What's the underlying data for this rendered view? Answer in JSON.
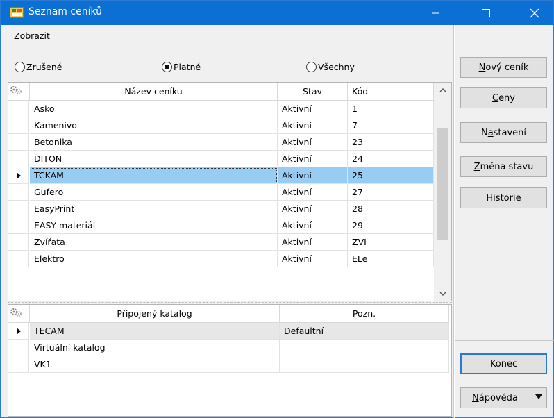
{
  "window": {
    "title": "Seznam ceníků",
    "accent": "#0b6fd4",
    "selection_color": "#99ccf3"
  },
  "filter": {
    "label": "Zobrazit",
    "options": [
      {
        "label": "Zrušené",
        "checked": false
      },
      {
        "label": "Platné",
        "checked": true
      },
      {
        "label": "Všechny",
        "checked": false
      }
    ]
  },
  "pricelists": {
    "columns": [
      "Název ceníku",
      "Stav",
      "Kód"
    ],
    "rows": [
      {
        "name": "Asko",
        "stav": "Aktivní",
        "kod": "1"
      },
      {
        "name": "Kamenivo",
        "stav": "Aktivní",
        "kod": "7"
      },
      {
        "name": "Betonika",
        "stav": "Aktivní",
        "kod": "23"
      },
      {
        "name": "DITON",
        "stav": "Aktivní",
        "kod": "24"
      },
      {
        "name": "TCKAM",
        "stav": "Aktivní",
        "kod": "25"
      },
      {
        "name": "Gufero",
        "stav": "Aktivní",
        "kod": "27"
      },
      {
        "name": "EasyPrint",
        "stav": "Aktivní",
        "kod": "28"
      },
      {
        "name": "EASY materiál",
        "stav": "Aktivní",
        "kod": "29"
      },
      {
        "name": "Zvířata",
        "stav": "Aktivní",
        "kod": "ZVI"
      },
      {
        "name": "Elektro",
        "stav": "Aktivní",
        "kod": "ELe"
      }
    ],
    "selected_index": 4,
    "scroll_position": 0.4
  },
  "catalogs": {
    "columns": [
      "Připojený katalog",
      "Pozn."
    ],
    "rows": [
      {
        "name": "TECAM",
        "pozn": "Defaultní"
      },
      {
        "name": "Virtuální katalog",
        "pozn": ""
      },
      {
        "name": "VK1",
        "pozn": ""
      }
    ],
    "selected_index": 0
  },
  "buttons": {
    "new": {
      "u": "N",
      "rest": "ový ceník"
    },
    "prices": {
      "u": "C",
      "rest": "eny"
    },
    "settings_a": "N",
    "settings_u": "a",
    "settings_b": "stavení",
    "status": {
      "u": "Z",
      "rest": "měna stavu"
    },
    "history": "Historie",
    "close": "Konec",
    "help": {
      "u": "N",
      "rest": "ápověda"
    }
  }
}
